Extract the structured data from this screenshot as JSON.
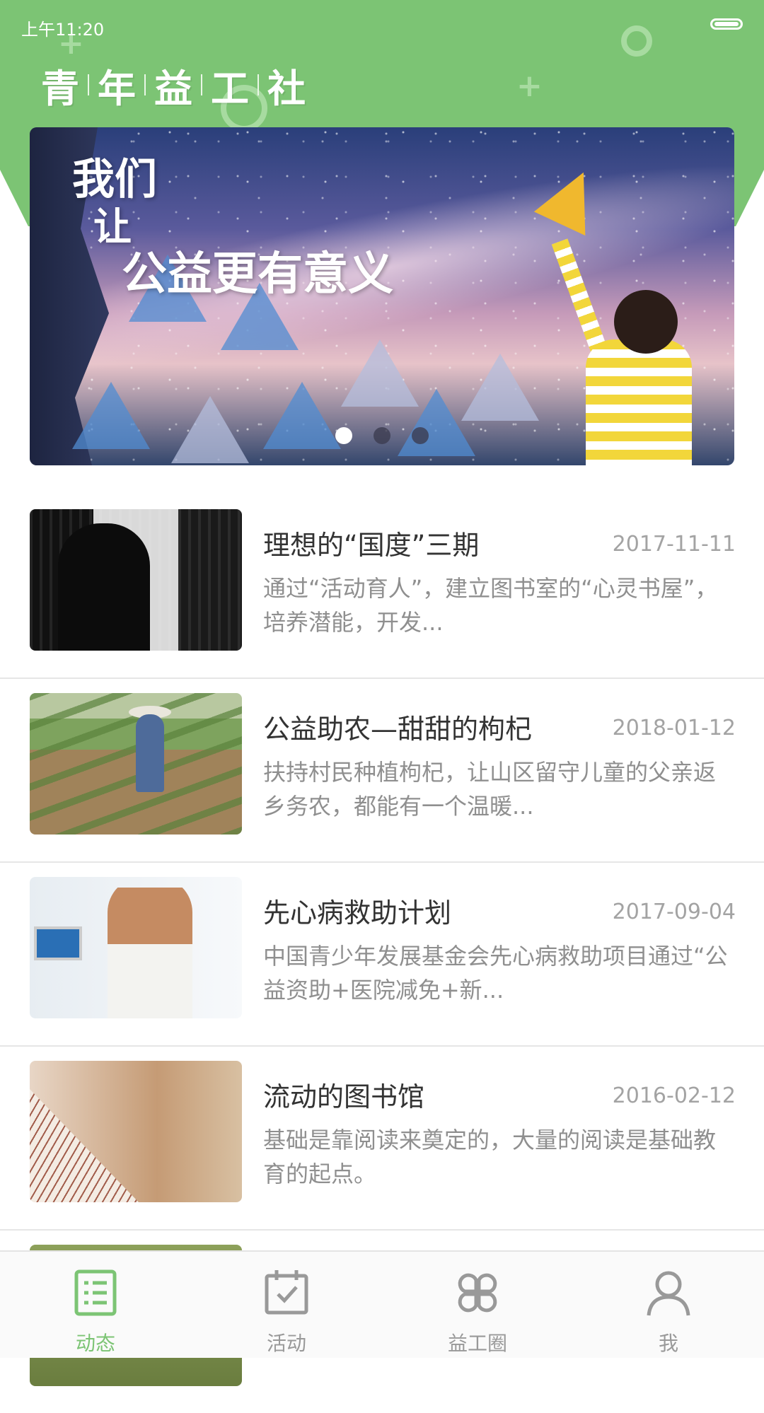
{
  "status_bar": {
    "time": "上午11:20"
  },
  "header": {
    "brand_chars": [
      "青",
      "年",
      "益",
      "工",
      "社"
    ]
  },
  "banner": {
    "slogan_line1": "我们",
    "slogan_line2": "让",
    "slogan_line3": "公益更有意义",
    "page_count": 3,
    "active_page": 1
  },
  "news": [
    {
      "title": "理想的“国度”三期",
      "date": "2017-11-11",
      "desc": "通过“活动育人”，建立图书室的“心灵书屋”，培养潜能，开发..."
    },
    {
      "title": "公益助农—甜甜的枸杞",
      "date": "2018-01-12",
      "desc": "扶持村民种植枸杞，让山区留守儿童的父亲返乡务农，都能有一个温暖..."
    },
    {
      "title": "先心病救助计划",
      "date": "2017-09-04",
      "desc": "中国青少年发展基金会先心病救助项目通过“公益资助+医院减免+新..."
    },
    {
      "title": "流动的图书馆",
      "date": "2016-02-12",
      "desc": "基础是靠阅读来奠定的，大量的阅读是基础教育的起点。"
    }
  ],
  "tabs": [
    {
      "label": "动态",
      "icon": "news-list-icon",
      "active": true
    },
    {
      "label": "活动",
      "icon": "calendar-check-icon",
      "active": false
    },
    {
      "label": "益工圈",
      "icon": "four-petal-icon",
      "active": false
    },
    {
      "label": "我",
      "icon": "user-icon",
      "active": false
    }
  ],
  "colors": {
    "brand_green": "#7cc474",
    "tab_inactive": "#999999",
    "title_text": "#333333",
    "desc_text": "#8f8f8f"
  }
}
